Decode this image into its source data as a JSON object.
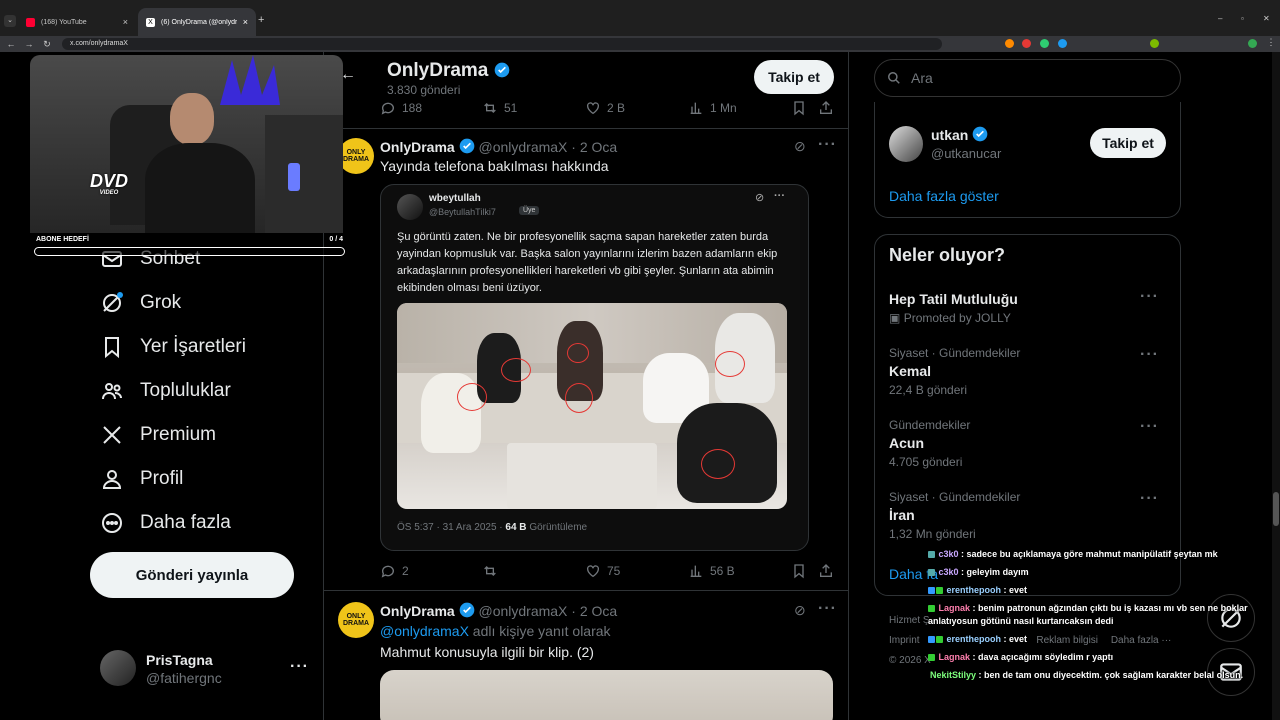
{
  "browser": {
    "tabs": [
      {
        "title": "(168) YouTube",
        "favicon_color": "#ff0033"
      },
      {
        "title": "(6) OnlyDrama (@onlydramaX) / X",
        "favicon_color": "#ffffff"
      }
    ],
    "url": "x.com/onlydramaX"
  },
  "profile_header": {
    "name": "OnlyDrama",
    "post_count": "3.830 gönderi",
    "follow_label": "Takip et"
  },
  "sidenav": {
    "items": [
      {
        "label": "Sohbet",
        "icon": "mail-icon"
      },
      {
        "label": "Grok",
        "icon": "grok-icon"
      },
      {
        "label": "Yer İşaretleri",
        "icon": "bookmark-icon"
      },
      {
        "label": "Topluluklar",
        "icon": "communities-icon"
      },
      {
        "label": "Premium",
        "icon": "x-logo-icon"
      },
      {
        "label": "Profil",
        "icon": "person-icon"
      },
      {
        "label": "Daha fazla",
        "icon": "more-circle-icon"
      }
    ],
    "post_button": "Gönderi yayınla",
    "account": {
      "name": "PrisTagna",
      "handle": "@fatihergnc",
      "more": "···"
    }
  },
  "top_actions": {
    "replies": "188",
    "reposts": "51",
    "likes": "2 B",
    "views": "1 Mn"
  },
  "tweet1": {
    "name": "OnlyDrama",
    "handle": "@onlydramaX",
    "date": "· 2 Oca",
    "text": "Yayında telefona bakılması hakkında",
    "avatar_text": "ONLY DRAMA",
    "quote": {
      "name": "wbeytullah",
      "handle": "@BeytullahTilki7",
      "badge": "Üye",
      "text": "Şu görüntü zaten. Ne bir profesyonellik saçma sapan hareketler zaten burda yayindan kopmusluk var. Başka salon yayınlarını izlerim bazen adamların ekip arkadaşlarının profesyonellikleri hareketleri vb gibi şeyler. Şunların ata abimin ekibinden olması beni üzüyor.",
      "time": "ÖS 5:37 · 31 Ara 2025 ·",
      "views": "64 B",
      "views_label": "Görüntüleme"
    },
    "actions": {
      "replies": "2",
      "reposts": "",
      "likes": "75",
      "views": "56 B"
    }
  },
  "tweet2": {
    "name": "OnlyDrama",
    "handle": "@onlydramaX",
    "date": "· 2 Oca",
    "reply_to": "@onlydramaX",
    "reply_suffix": " adlı kişiye yanıt olarak",
    "text": "Mahmut konusuyla ilgili bir klip. (2)",
    "avatar_text": "ONLY DRAMA"
  },
  "right": {
    "search_placeholder": "Ara",
    "follow_suggestion": {
      "name": "utkan",
      "handle": "@utkanucar",
      "button": "Takip et"
    },
    "show_more": "Daha fazla göster",
    "trends_title": "Neler oluyor?",
    "trends": [
      {
        "category": "",
        "name": "Hep Tatil Mutluluğu",
        "count": "Promoted by JOLLY"
      },
      {
        "category": "Siyaset · Gündemdekiler",
        "name": "Kemal",
        "count": "22,4 B gönderi"
      },
      {
        "category": "Gündemdekiler",
        "name": "Acun",
        "count": "4.705 gönderi"
      },
      {
        "category": "Siyaset · Gündemdekiler",
        "name": "İran",
        "count": "1,32 Mn gönderi"
      }
    ],
    "trends_more": "Daha fa",
    "footer": {
      "line1": "Hizmet Ş",
      "line2": "Imprint",
      "line3": "© 2026 X",
      "ads": "Reklam bilgisi",
      "more": "Daha fazla ···"
    }
  },
  "overlay": {
    "goal_label": "ABONE HEDEFİ",
    "goal_count": "0 / 4",
    "goal_progress": 0,
    "dvd_text": "DVD",
    "dvd_sub": "VIDEO",
    "chat": [
      {
        "user": "c3k0",
        "color": "#c9a8ff",
        "msg": " : sadece bu açıklamaya göre mahmut manipülatif şeytan mk"
      },
      {
        "user": "c3k0",
        "color": "#c9a8ff",
        "msg": " : geleyim dayım"
      },
      {
        "user": "erenthepooh",
        "color": "#9ad0ff",
        "msg": " : evet"
      },
      {
        "user": "Lagnak",
        "color": "#ff7fae",
        "msg": " : benim patronun ağzından çıktı bu iş kazası mı vb sen ne boklar anlatıyosun götünü nasıl kurtarıcaksın dedi"
      },
      {
        "user": "erenthepooh",
        "color": "#9ad0ff",
        "msg": " : evet"
      },
      {
        "user": "Lagnak",
        "color": "#ff7fae",
        "msg": " : dava açıcağımı söyledim r yaptı"
      },
      {
        "user": "NekitStilyy",
        "color": "#7dff7d",
        "msg": " : ben de tam onu diyecektim. çok sağlam karakter belal olsun."
      }
    ]
  }
}
